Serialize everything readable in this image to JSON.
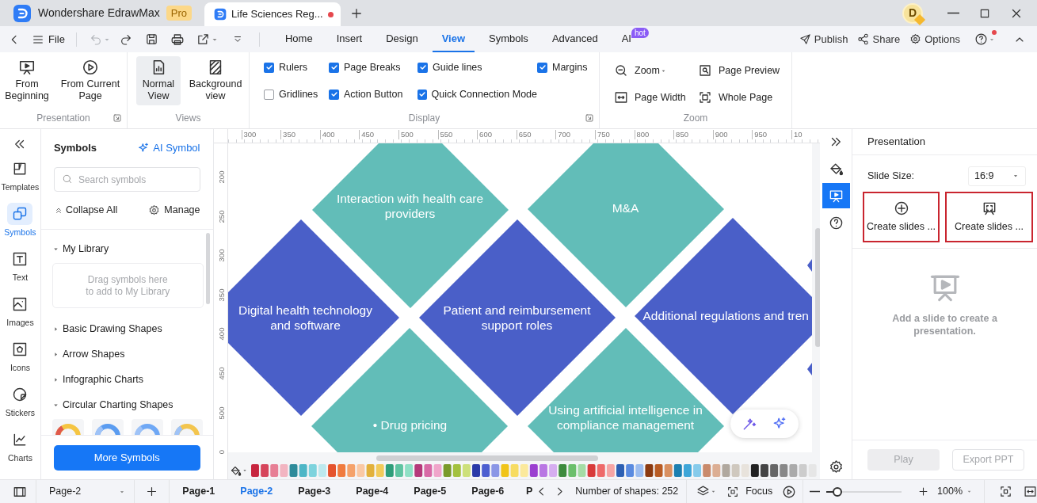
{
  "app_tab": {
    "title": "Wondershare EdrawMax",
    "badge": "Pro"
  },
  "document_tab": {
    "title": "Life Sciences Reg...",
    "unsaved": true
  },
  "account": {
    "initial": "D"
  },
  "menu": {
    "file": "File",
    "tabs": [
      {
        "label": "Home",
        "selected": false
      },
      {
        "label": "Insert",
        "selected": false
      },
      {
        "label": "Design",
        "selected": false
      },
      {
        "label": "View",
        "selected": true
      },
      {
        "label": "Symbols",
        "selected": false
      },
      {
        "label": "Advanced",
        "selected": false
      },
      {
        "label": "AI",
        "selected": false,
        "badge": "hot"
      }
    ],
    "actions": [
      "Publish",
      "Share",
      "Options"
    ]
  },
  "ribbon": {
    "presentation": {
      "label": "Presentation",
      "buttons": [
        "From Beginning",
        "From Current Page"
      ]
    },
    "views": {
      "label": "Views",
      "buttons": [
        {
          "label": "Normal View",
          "selected": true
        },
        {
          "label": "Background view",
          "selected": false
        }
      ]
    },
    "display": {
      "label": "Display",
      "options": [
        {
          "label": "Rulers",
          "checked": true
        },
        {
          "label": "Page Breaks",
          "checked": true
        },
        {
          "label": "Guide lines",
          "checked": true
        },
        {
          "label": "Margins",
          "checked": true
        },
        {
          "label": "Gridlines",
          "checked": false
        },
        {
          "label": "Action Button",
          "checked": true
        },
        {
          "label": "Quick Connection Mode",
          "checked": true
        }
      ]
    },
    "zoom": {
      "label": "Zoom",
      "buttons": [
        "Zoom",
        "Page Preview",
        "Page Width",
        "Whole Page"
      ]
    }
  },
  "left_rail": {
    "items": [
      {
        "label": "Templates",
        "selected": false
      },
      {
        "label": "Symbols",
        "selected": true
      },
      {
        "label": "Text",
        "selected": false
      },
      {
        "label": "Images",
        "selected": false
      },
      {
        "label": "Icons",
        "selected": false
      },
      {
        "label": "Stickers",
        "selected": false
      },
      {
        "label": "Charts",
        "selected": false
      }
    ]
  },
  "symbols_panel": {
    "title": "Symbols",
    "ai_button": "AI Symbol",
    "search": {
      "placeholder": "Search symbols"
    },
    "collapse_all": "Collapse All",
    "manage": "Manage",
    "sections": [
      {
        "label": "My Library",
        "expanded": true,
        "hint": "Drag symbols here\nto add to My Library"
      },
      {
        "label": "Basic Drawing Shapes",
        "expanded": false
      },
      {
        "label": "Arrow Shapes",
        "expanded": false
      },
      {
        "label": "Infographic Charts",
        "expanded": false
      },
      {
        "label": "Circular Charting Shapes",
        "expanded": true
      }
    ],
    "more_button": "More Symbols"
  },
  "rulers": {
    "horizontal": [
      "300",
      "350",
      "400",
      "450",
      "500",
      "550",
      "600",
      "650",
      "700",
      "750",
      "800",
      "850",
      "900",
      "950",
      "10"
    ],
    "vertical": [
      "200",
      "250",
      "300",
      "350",
      "400",
      "450",
      "500",
      "0"
    ]
  },
  "canvas": {
    "shapes": [
      {
        "text": "Interaction with health care providers",
        "color": "#62bdb8"
      },
      {
        "text": "M&A",
        "color": "#62bdb8"
      },
      {
        "text": "Digital health technology and software",
        "color": "#4a5fc8"
      },
      {
        "text": "Patient and reimbursement support roles",
        "color": "#4a5fc8"
      },
      {
        "text": "Additional regulations and tren",
        "color": "#4a5fc8"
      },
      {
        "text": "• Drug pricing",
        "color": "#62bdb8"
      },
      {
        "text": "Using artificial intelligence in compliance management",
        "color": "#62bdb8"
      }
    ]
  },
  "right_rail": {
    "items": [
      {
        "kind": "fill",
        "selected": false
      },
      {
        "kind": "presentation",
        "selected": true
      },
      {
        "kind": "help",
        "selected": false
      }
    ]
  },
  "presentation_panel": {
    "title": "Presentation",
    "slide_size": {
      "label": "Slide Size:",
      "value": "16:9"
    },
    "create_buttons": [
      "Create slides ...",
      "Create slides ..."
    ],
    "empty_message": "Add a slide to create a presentation.",
    "play": {
      "label": "Play",
      "disabled": true
    },
    "export": {
      "label": "Export PPT",
      "disabled": true
    }
  },
  "bottom_bar": {
    "page_select": "Page-2",
    "pages": [
      {
        "label": "Page-1",
        "selected": false
      },
      {
        "label": "Page-2",
        "selected": true
      },
      {
        "label": "Page-3",
        "selected": false
      },
      {
        "label": "Page-4",
        "selected": false
      },
      {
        "label": "Page-5",
        "selected": false
      },
      {
        "label": "Page-6",
        "selected": false
      },
      {
        "label": "P",
        "selected": false
      }
    ],
    "shape_count": "Number of shapes: 252",
    "focus": "Focus",
    "zoom": {
      "level": 0.15,
      "value": "100%"
    }
  }
}
